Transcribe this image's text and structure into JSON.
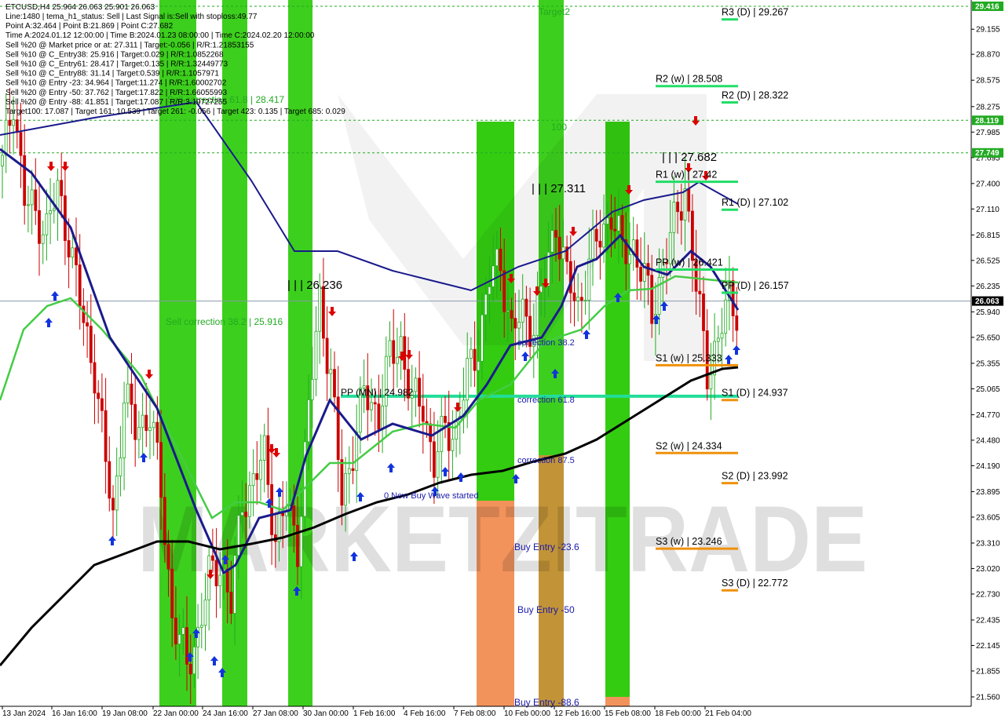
{
  "chart_data": {
    "type": "candlestick",
    "symbol": "ETCUSD,H4",
    "ohlc_header": "ETCUSD,H4  25.964 26.063 25.901 26.063",
    "info_lines": [
      "Line:1480  |  tema_h1_status: Sell  |  Last Signal is:Sell with stoploss:49.77",
      "Point A:32.464  |  Point B:21.869  |  Point C:27.682",
      "Time A:2024.01.12 12:00:00  |  Time B:2024.01.23 08:00:00  |  Time C:2024.02.20 12:00:00",
      "Sell %20 @ Market price or at: 27.311  |  Target:-0.056  |  R/R:1.21853155",
      "Sell %10 @ C_Entry38: 25.916  |  Target:0.029  |  R/R:1.0852268",
      "Sell %10 @ C_Entry61: 28.417  |  Target:0.135  |  R/R:1.32449773",
      "Sell %10 @ C_Entry88: 31.14  |  Target:0.539  |  R/R:1.1057971",
      "Sell %10 @ Entry -23: 34.964  |  Target:11.274  |  R/R:1.60002702",
      "Sell %20 @ Entry -50: 37.762  |  Target:17.822  |  R/R:1.66055993",
      "Sell %20 @ Entry -88: 41.851  |  Target:17.087  |  R/R:3.19727255",
      "Target100: 17.087  |  Target 161: 10.539  |  Target 261: -0.056  |  Target 423: 0.135  |  Target 685: 0.029"
    ],
    "y_ticks": [
      "29.155",
      "28.870",
      "28.575",
      "28.275",
      "27.985",
      "27.695",
      "27.400",
      "27.110",
      "26.815",
      "26.525",
      "26.235",
      "25.940",
      "25.650",
      "25.355",
      "25.065",
      "24.770",
      "24.480",
      "24.190",
      "23.895",
      "23.605",
      "23.310",
      "23.020",
      "22.730",
      "22.435",
      "22.145",
      "21.855",
      "21.560"
    ],
    "x_ticks": [
      "13 Jan 2024",
      "16 Jan 16:00",
      "19 Jan 08:00",
      "22 Jan 00:00",
      "24 Jan 16:00",
      "27 Jan 08:00",
      "30 Jan 00:00",
      "1 Feb 16:00",
      "4 Feb 16:00",
      "7 Feb 08:00",
      "10 Feb 00:00",
      "12 Feb 16:00",
      "15 Feb 08:00",
      "18 Feb 00:00",
      "21 Feb 04:00"
    ],
    "ylim": [
      21.56,
      29.45
    ],
    "price_boxes": [
      {
        "value": 29.416,
        "label": "29.416",
        "color": "#22aa22"
      },
      {
        "value": 28.119,
        "label": "28.119",
        "color": "#22aa22"
      },
      {
        "value": 27.749,
        "label": "27.749",
        "color": "#22aa22"
      },
      {
        "value": 26.063,
        "label": "26.063",
        "color": "#000000"
      }
    ],
    "pivot_levels": [
      {
        "label": "R3 (D) | 29.267",
        "value": 29.267,
        "color": "#22dd66"
      },
      {
        "label": "R2 (w) | 28.508",
        "value": 28.508,
        "color": "#22dd66"
      },
      {
        "label": "R2 (D) | 28.322",
        "value": 28.322,
        "color": "#22dd66"
      },
      {
        "label": "R1 (w) | 27.42",
        "value": 27.42,
        "color": "#22dd66"
      },
      {
        "label": "R1 (D) | 27.102",
        "value": 27.102,
        "color": "#22dd66"
      },
      {
        "label": "PP (w) | 26.421",
        "value": 26.421,
        "color": "#22dd66"
      },
      {
        "label": "PP (D) | 26.157",
        "value": 26.157,
        "color": "#22dd66"
      },
      {
        "label": "S1 (w) | 25.333",
        "value": 25.333,
        "color": "#f0900a"
      },
      {
        "label": "S1 (D) | 24.937",
        "value": 24.937,
        "color": "#f0900a"
      },
      {
        "label": "S2 (w) | 24.334",
        "value": 24.334,
        "color": "#f0900a"
      },
      {
        "label": "S2 (D) | 23.992",
        "value": 23.992,
        "color": "#f0900a"
      },
      {
        "label": "S3 (w) | 23.246",
        "value": 23.246,
        "color": "#f0900a"
      },
      {
        "label": "S3 (D) | 22.772",
        "value": 22.772,
        "color": "#f0900a"
      }
    ],
    "annotations": [
      {
        "text": "Target2",
        "color": "#22aa22"
      },
      {
        "text": "100",
        "color": "#22aa22"
      },
      {
        "text": "| | | 27.682",
        "color": "#000000"
      },
      {
        "text": "| | | 27.311",
        "color": "#000000"
      },
      {
        "text": "| | | 26.236",
        "color": "#000000"
      },
      {
        "text": "Sell correction 38.2 | 25.916",
        "color": "#22aa22"
      },
      {
        "text": "Sell correction 61.8 | 28.417",
        "color": "#22aa22"
      },
      {
        "text": "PP (MN) | 24.982",
        "color": "#000000"
      },
      {
        "text": "correction 38.2",
        "color": "#1a1aaa"
      },
      {
        "text": "correction 61.8",
        "color": "#1a1aaa"
      },
      {
        "text": "correction 87.5",
        "color": "#1a1aaa"
      },
      {
        "text": "0 New Buy Wave started",
        "color": "#1a1aaa"
      },
      {
        "text": "Buy Entry -23.6",
        "color": "#1a1aaa"
      },
      {
        "text": "Buy Entry -50",
        "color": "#1a1aaa"
      },
      {
        "text": "Buy Entry -88.6",
        "color": "#1a1aaa"
      }
    ],
    "watermark": "MARKETZITRADE",
    "colors": {
      "up": "#22aa22",
      "down": "#cc0000",
      "ma_blue": "#1a1a8c",
      "ma_green": "#44cc44",
      "ma_black": "#000000",
      "zone_green": "#33cc11",
      "zone_orange": "#f08040",
      "hline_green": "#22aa22"
    }
  }
}
